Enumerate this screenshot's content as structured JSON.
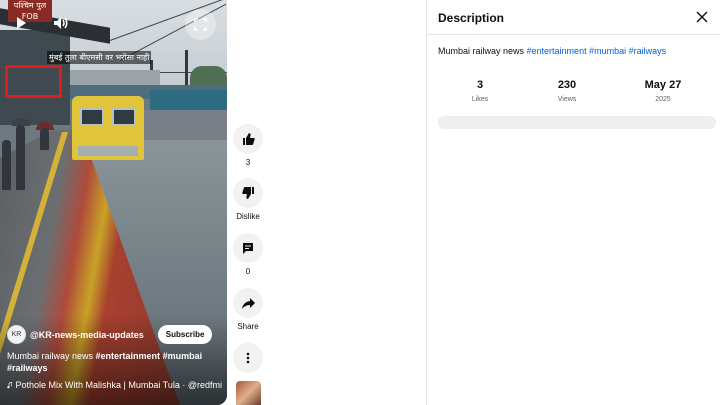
{
  "player": {
    "station_sign": "पश्चिम पुल\nFOB",
    "overlay_text": "मुंबई तुला बीएमसी वर भरोसा नाही",
    "channel": {
      "avatar_initial": "KR",
      "name": "@KR-news-media-updates",
      "subscribe_label": "Subscribe"
    },
    "caption": {
      "text": "Mumbai railway news ",
      "tags": [
        "#entertainment",
        "#mumbai",
        "#railways"
      ]
    },
    "music": "Pothole Mix With Malishka | Mumbai Tula · @redfmi"
  },
  "actions": {
    "like_count": "3",
    "dislike_label": "Dislike",
    "comment_count": "0",
    "share_label": "Share"
  },
  "description_panel": {
    "title": "Description",
    "text": "Mumbai railway news ",
    "tags": [
      "#entertainment",
      "#mumbai",
      "#railways"
    ],
    "stats": [
      {
        "value": "3",
        "label": "Likes"
      },
      {
        "value": "230",
        "label": "Views"
      },
      {
        "value": "May 27",
        "label": "2025"
      }
    ]
  },
  "icons": [
    "play-icon",
    "volume-icon",
    "fullscreen-icon",
    "like-icon",
    "dislike-icon",
    "comment-icon",
    "share-icon",
    "more-icon",
    "music-note-icon",
    "close-icon"
  ],
  "colors": {
    "link": "#065fd4",
    "highlight_box": "#e11a1a"
  }
}
